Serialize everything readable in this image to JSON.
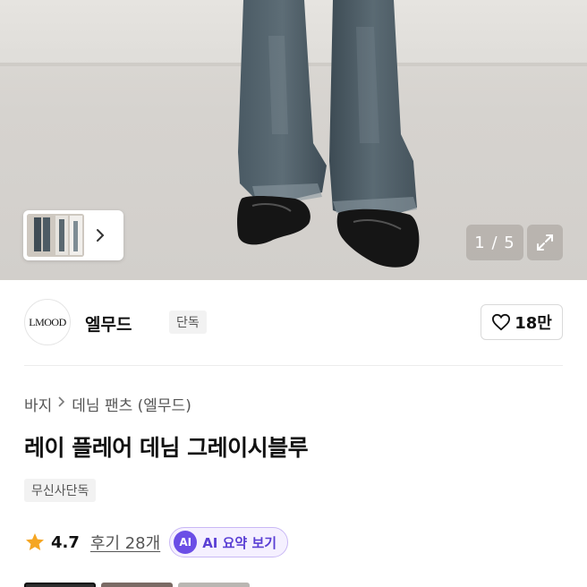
{
  "gallery": {
    "counter": "1 / 5",
    "thumb_next_icon": "chevron-right-icon",
    "expand_icon": "expand-icon"
  },
  "brand": {
    "logo_text": "LMOOD",
    "name": "엘무드",
    "badge": "단독",
    "like_icon": "heart-outline-icon",
    "like_count": "18만"
  },
  "breadcrumb": {
    "items": [
      "바지",
      "데님 팬츠 (엘무드)"
    ],
    "separator_icon": "chevron-right-icon"
  },
  "product": {
    "title": "레이 플레어 데님 그레이시블루",
    "tag": "무신사단독"
  },
  "rating": {
    "star_icon": "star-icon",
    "value": "4.7",
    "review_link": "후기 28개",
    "ai_badge": "AI",
    "ai_label": "AI 요약 보기"
  },
  "colors": {
    "accent_purple": "#6b4ee6",
    "star_orange": "#f5a623"
  }
}
